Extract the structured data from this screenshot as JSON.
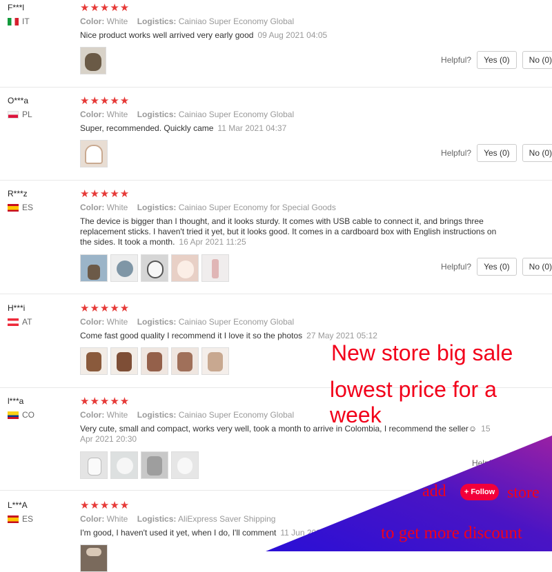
{
  "labels": {
    "color": "Color:",
    "logistics": "Logistics:",
    "helpful": "Helpful?",
    "stars": "★★★★★"
  },
  "reviews": [
    {
      "user": "F***l",
      "country": "IT",
      "color": "White",
      "logistics": "Cainiao Super Economy Global",
      "text": "Nice product works well arrived very early good",
      "date": "09 Aug 2021 04:05",
      "yes": "Yes (0)",
      "no": "No (0)",
      "photos": 1
    },
    {
      "user": "O***a",
      "country": "PL",
      "color": "White",
      "logistics": "Cainiao Super Economy Global",
      "text": "Super, recommended. Quickly came",
      "date": "11 Mar 2021 04:37",
      "yes": "Yes (0)",
      "no": "No (0)",
      "photos": 1
    },
    {
      "user": "R***z",
      "country": "ES",
      "color": "White",
      "logistics": "Cainiao Super Economy for Special Goods",
      "text": "The device is bigger than I thought, and it looks sturdy. It comes with USB cable to connect it, and brings three replacement sticks. I haven't tried it yet, but it looks good. It comes in a cardboard box with English instructions on the sides. It took a month.",
      "date": "16 Apr 2021 11:25",
      "yes": "Yes (0)",
      "no": "No (0)",
      "photos": 5
    },
    {
      "user": "H***i",
      "country": "AT",
      "color": "White",
      "logistics": "Cainiao Super Economy Global",
      "text": "Come fast good quality I recommend it I love it so the photos",
      "date": "27 May 2021 05:12",
      "photos": 5
    },
    {
      "user": "l***a",
      "country": "CO",
      "color": "White",
      "logistics": "Cainiao Super Economy Global",
      "text": "Very cute, small and compact, works very well, took a month to arrive in Colombia, I recommend the seller☺",
      "date": "15 Apr 2021 20:30",
      "photos": 4
    },
    {
      "user": "L***A",
      "country": "ES",
      "color": "White",
      "logistics": "AliExpress Saver Shipping",
      "text": "I'm good, I haven't used it yet, when I do, I'll comment",
      "date": "11 Jun 2021",
      "photos": 1
    }
  ],
  "promo": {
    "line1": "New store big sale",
    "line2": "lowest price for a week",
    "add": "add",
    "follow": "+ Follow",
    "store": "store",
    "discount": "to get more discount"
  },
  "colors": {
    "star": "#e63a38",
    "promo_text": "#f2001a",
    "banner_blue": "#3a12c8",
    "banner_purple": "#8a1ea8"
  }
}
